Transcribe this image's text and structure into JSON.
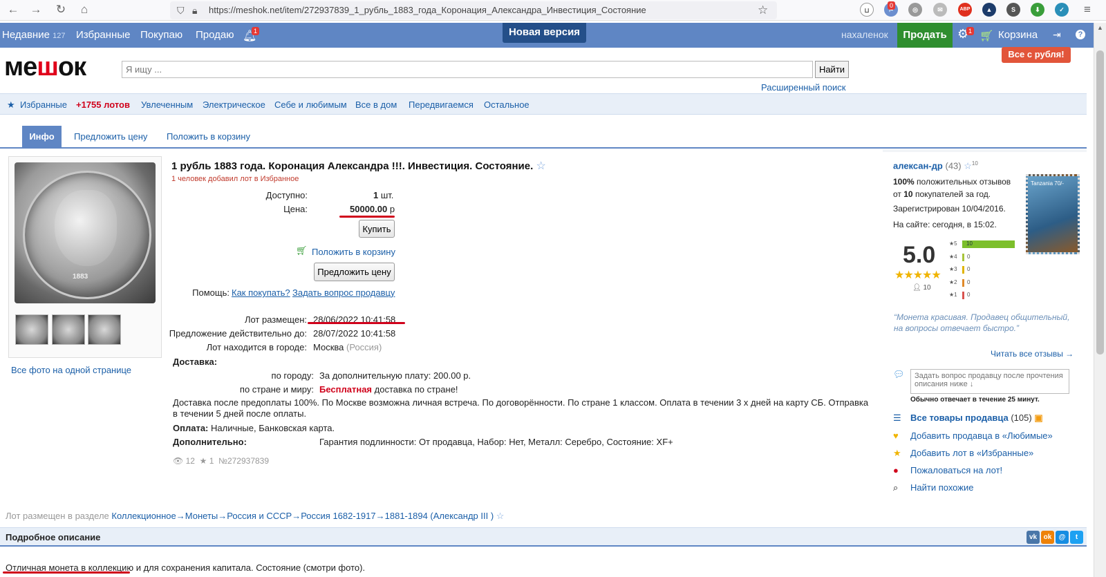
{
  "browser": {
    "url": "https://meshok.net/item/272937839_1_рубль_1883_года_Коронация_Александра_Инвестиция_Состояние",
    "ext_badge": "0"
  },
  "topnav": {
    "recent": "Недавние",
    "recent_count": "127",
    "favorites": "Избранные",
    "buying": "Покупаю",
    "selling": "Продаю",
    "bell_badge": "1",
    "new_version": "Новая версия",
    "username": "нахаленок",
    "sell_button": "Продать",
    "gear_badge": "1",
    "cart": "Корзина"
  },
  "header": {
    "logo_pre": "ме",
    "logo_mid": "ш",
    "logo_post": "ок",
    "search_placeholder": "Я ищу ...",
    "find_button": "Найти",
    "advanced_search": "Расширенный поиск",
    "promo": "Все с рубля!"
  },
  "categories": {
    "favorites": "Избранные",
    "new_lots": "+1755 лотов",
    "items": [
      "Увлеченным",
      "Электрическое",
      "Себе и любимым",
      "Все в дом",
      "Передвигаемся",
      "Остальное"
    ]
  },
  "tabs": [
    "Инфо",
    "Предложить цену",
    "Положить в корзину"
  ],
  "gallery": {
    "coin_year": "1883",
    "all_photos": "Все фото на одной странице"
  },
  "lot": {
    "title": "1 рубль 1883 года. Коронация Александра !!!. Инвестиция. Состояние.",
    "favorites_note": "1 человек добавил лот в Избранное",
    "available_label": "Доступно:",
    "available_value": "1",
    "available_unit": "шт.",
    "price_label": "Цена:",
    "price_value": "50000.00",
    "price_currency": "р",
    "buy_button": "Купить",
    "add_to_cart": "Положить в корзину",
    "offer_button": "Предложить цену",
    "help_label": "Помощь:",
    "help_how": "Как покупать?",
    "help_ask": "Задать вопрос продавцу",
    "placed_label": "Лот размещен:",
    "placed_value": "28/06/2022 10:41:58",
    "valid_label": "Предложение действительно до:",
    "valid_value": "28/07/2022 10:41:58",
    "city_label": "Лот находится в городе:",
    "city_value": "Москва",
    "country_value": "(Россия)",
    "delivery_label": "Доставка:",
    "city_delivery_label": "по городу:",
    "city_delivery_value": "За дополнительную плату: 200.00 р.",
    "country_delivery_label": "по стране и миру:",
    "country_delivery_free": "Бесплатная",
    "country_delivery_rest": "доставка по стране!",
    "delivery_note": "Доставка после предоплаты 100%. По Москве возможна личная встреча. По договорённости. По стране 1 классом. Оплата в течении 3 х дней на карту СБ. Отправка в течении 5 дней после оплаты.",
    "payment_label": "Оплата:",
    "payment_value": "Наличные, Банковская карта.",
    "extra_label": "Дополнительно:",
    "extra_value": "Гарантия подлинности: От продавца, Набор: Нет, Металл: Серебро, Состояние: XF+",
    "views": "12",
    "stars": "1",
    "lot_number": "№272937839"
  },
  "seller": {
    "name": "алексан-др",
    "count": "(43)",
    "star_count": "10",
    "positive_pct": "100%",
    "positive_text": "положительных отзывов",
    "from_text": "от",
    "buyers_count": "10",
    "buyers_text": "покупателей за год.",
    "registered": "Зарегистрирован 10/04/2016.",
    "online": "На сайте: сегодня, в 15:02.",
    "rating": "5.0",
    "rating_votes": "10",
    "stamp_text": "Tanzania 70/-",
    "breakdown": [
      {
        "stars": "5",
        "count": "10",
        "fraction": 1.0,
        "color": "#7cbf2b"
      },
      {
        "stars": "4",
        "count": "0",
        "fraction": 0,
        "color": "#a8c43a"
      },
      {
        "stars": "3",
        "count": "0",
        "fraction": 0,
        "color": "#e0b400"
      },
      {
        "stars": "2",
        "count": "0",
        "fraction": 0,
        "color": "#e08a2a"
      },
      {
        "stars": "1",
        "count": "0",
        "fraction": 0,
        "color": "#d9534f"
      }
    ],
    "review": "“Монета красивая. Продавец общительный, на вопросы отвечает быстро.”",
    "read_all": "Читать все отзывы →",
    "ask_placeholder": "Задать вопрос продавцу после прочтения описания ниже ↓",
    "response_time": "Обычно отвечает в течение 25 минут.",
    "all_items": "Все товары продавца",
    "all_items_count": "(105)",
    "add_fav_seller": "Добавить продавца в «Любимые»",
    "add_fav_lot": "Добавить лот в «Избранные»",
    "complain": "Пожаловаться на лот!",
    "find_similar": "Найти похожие"
  },
  "breadcrumb": {
    "label": "Лот размещен в разделе",
    "items": [
      "Коллекционное→",
      "Монеты→",
      "Россия и СССР→",
      "Россия 1682-1917→",
      "1881-1894 (Александр III )"
    ]
  },
  "description": {
    "header": "Подробное описание",
    "text_underlined": "Отличная монета в коллекцию",
    "text_rest": " и для сохранения капитала. Состояние (смотри фото)."
  },
  "share": [
    "vk",
    "ok",
    "mm",
    "tw"
  ],
  "colors": {
    "nav_bg": "#5f86c4",
    "sell_green": "#2f8e2f",
    "accent_red": "#d0021b",
    "link_blue": "#1b5fa8"
  }
}
